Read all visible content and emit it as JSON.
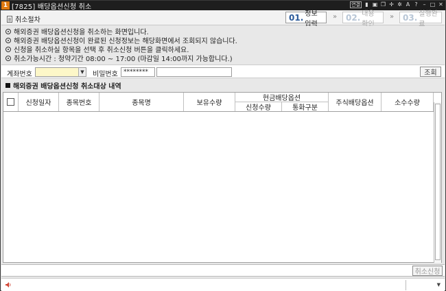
{
  "window": {
    "number": "1",
    "title": "[7825] 배당옵션신청 취소",
    "toolbar_icons": [
      "연결",
      "mouse-icon",
      "save-icon",
      "copy-icon",
      "pin-icon",
      "settings-icon",
      "font-icon",
      "help-icon",
      "minimize-icon",
      "maximize-icon",
      "close-icon"
    ],
    "toolbar_box_label": "연결"
  },
  "steps": {
    "label": "취소절차",
    "items": [
      {
        "num": "01.",
        "text": "정보입력",
        "state": "active"
      },
      {
        "num": "02.",
        "text": "내용확인",
        "state": "inactive"
      },
      {
        "num": "03.",
        "text": "실행완료",
        "state": "inactive"
      }
    ],
    "arrow": "»"
  },
  "notices": [
    "해외증권 배당옵션신청을 취소하는 화면입니다.",
    "해외증권 배당옵션신청이 완료된 신청정보는 해당화면에서 조회되지 않습니다.",
    "신청을 취소하실 항목을 선택 후 취소신청 버튼을 클릭하세요.",
    "취소가능시간 : 청약기간 08:00 ~ 17:00 (마감일 14:00까지 가능합니다.)"
  ],
  "form": {
    "account_label": "계좌번호",
    "account_value": "",
    "password_label": "비밀번호",
    "password_value": "********",
    "search_button": "조회"
  },
  "section": {
    "title": "해외증권 배당옵션신청 취소대상 내역"
  },
  "table": {
    "columns": {
      "apply_date": "신청일자",
      "stock_code": "종목번호",
      "stock_name": "종목명",
      "holding_qty": "보유수량",
      "cash_group": "현금배당옵션",
      "apply_qty": "신청수량",
      "currency": "통화구분",
      "stock_dividend": "주식배당옵션",
      "fee_qty": "소수수량"
    },
    "rows": []
  },
  "bottom": {
    "cancel_button": "취소신청"
  },
  "status": {
    "message": ""
  }
}
